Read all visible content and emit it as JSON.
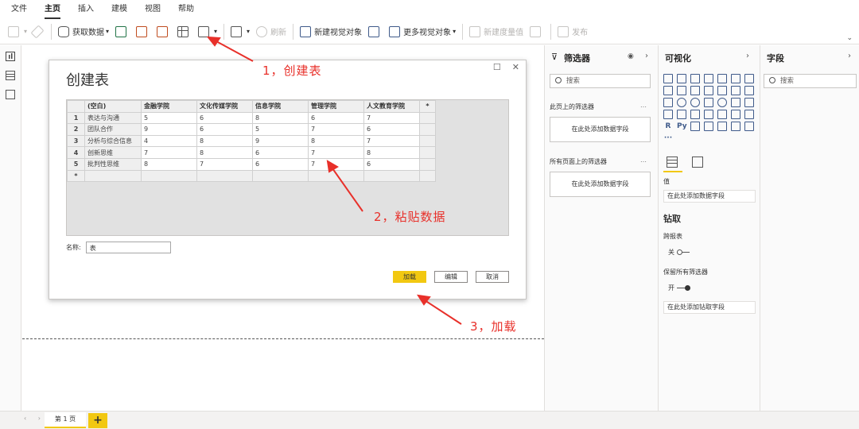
{
  "menu": [
    "文件",
    "主页",
    "插入",
    "建模",
    "视图",
    "帮助"
  ],
  "ribbon": {
    "get_data": "获取数据",
    "refresh": "刷新",
    "new_visual": "新建视觉对象",
    "more_visuals": "更多视觉对象",
    "new_measure": "新建度量值",
    "publish": "发布"
  },
  "dialog": {
    "title": "创建表",
    "table": {
      "headers": [
        "(空白)",
        "金融学院",
        "文化传媒学院",
        "信息学院",
        "管理学院",
        "人文教育学院",
        "*"
      ],
      "rows": [
        {
          "n": "1",
          "cells": [
            "表达与沟通",
            "5",
            "6",
            "8",
            "6",
            "7"
          ]
        },
        {
          "n": "2",
          "cells": [
            "团队合作",
            "9",
            "6",
            "5",
            "7",
            "6"
          ]
        },
        {
          "n": "3",
          "cells": [
            "分析与综合信息",
            "4",
            "8",
            "9",
            "8",
            "7"
          ]
        },
        {
          "n": "4",
          "cells": [
            "创新思维",
            "7",
            "8",
            "6",
            "7",
            "8"
          ]
        },
        {
          "n": "5",
          "cells": [
            "批判性思维",
            "8",
            "7",
            "6",
            "7",
            "6"
          ]
        }
      ],
      "new_row_marker": "*"
    },
    "name_label": "名称:",
    "name_value": "表",
    "load": "加载",
    "edit": "编辑",
    "cancel": "取消"
  },
  "annotations": {
    "step1": "1，创建表",
    "step2": "2，粘贴数据",
    "step3": "3，加载"
  },
  "filters": {
    "title": "筛选器",
    "search_placeholder": "搜索",
    "page_section": "此页上的筛选器",
    "all_pages_section": "所有页面上的筛选器",
    "drop_hint": "在此处添加数据字段"
  },
  "visualizations": {
    "title": "可视化",
    "values_label": "值",
    "values_hint": "在此处添加数据字段",
    "drillthrough_title": "钻取",
    "cross_report": "跨报表",
    "off": "关",
    "keep_filters": "保留所有筛选器",
    "on": "开",
    "drill_hint": "在此处添加钻取字段"
  },
  "fields": {
    "title": "字段",
    "search_placeholder": "搜索"
  },
  "pages": {
    "tab": "第 1 页",
    "add": "+"
  },
  "colors": {
    "accent": "#f2c811",
    "annotation": "#e8302a"
  }
}
